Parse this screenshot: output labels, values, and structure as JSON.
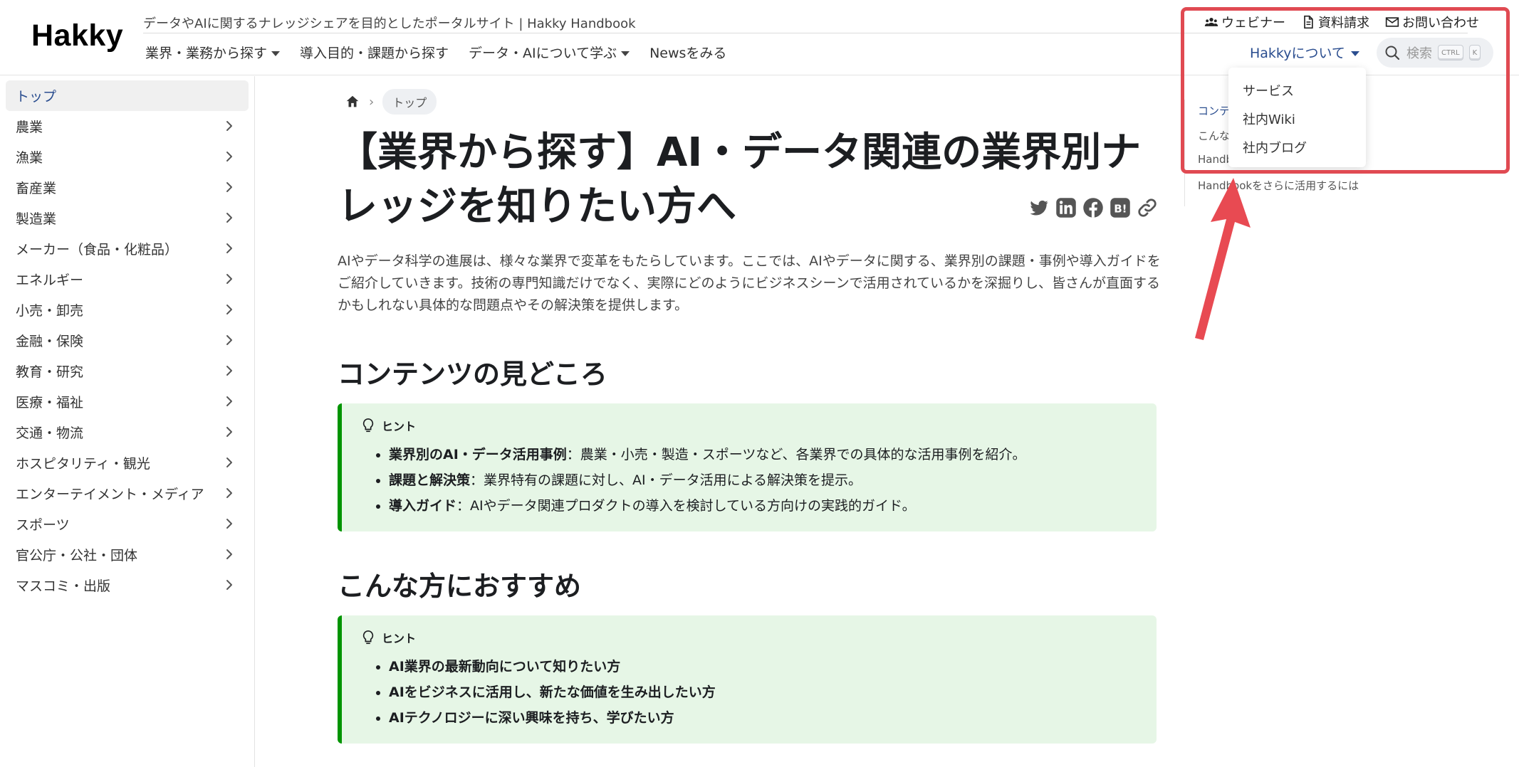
{
  "header": {
    "logo": "Hakky",
    "tagline": "データやAIに関するナレッジシェアを目的としたポータルサイト | Hakky Handbook",
    "nav": [
      {
        "label": "業界・業務から探す",
        "has_caret": true
      },
      {
        "label": "導入目的・課題から探す",
        "has_caret": false
      },
      {
        "label": "データ・AIについて学ぶ",
        "has_caret": true
      },
      {
        "label": "Newsをみる",
        "has_caret": false
      }
    ],
    "utility": [
      {
        "label": "ウェビナー",
        "icon": "users-icon"
      },
      {
        "label": "資料請求",
        "icon": "document-icon"
      },
      {
        "label": "お問い合わせ",
        "icon": "mail-icon"
      }
    ],
    "about": {
      "label": "Hakkyについて"
    },
    "search": {
      "placeholder": "検索",
      "key1": "CTRL",
      "key2": "K"
    }
  },
  "dropdown": {
    "items": [
      "サービス",
      "社内Wiki",
      "社内ブログ"
    ]
  },
  "sidebar": {
    "items": [
      {
        "label": "トップ",
        "active": true,
        "chevron": false
      },
      {
        "label": "農業",
        "active": false,
        "chevron": true
      },
      {
        "label": "漁業",
        "active": false,
        "chevron": true
      },
      {
        "label": "畜産業",
        "active": false,
        "chevron": true
      },
      {
        "label": "製造業",
        "active": false,
        "chevron": true
      },
      {
        "label": "メーカー（食品・化粧品）",
        "active": false,
        "chevron": true
      },
      {
        "label": "エネルギー",
        "active": false,
        "chevron": true
      },
      {
        "label": "小売・卸売",
        "active": false,
        "chevron": true
      },
      {
        "label": "金融・保険",
        "active": false,
        "chevron": true
      },
      {
        "label": "教育・研究",
        "active": false,
        "chevron": true
      },
      {
        "label": "医療・福祉",
        "active": false,
        "chevron": true
      },
      {
        "label": "交通・物流",
        "active": false,
        "chevron": true
      },
      {
        "label": "ホスピタリティ・観光",
        "active": false,
        "chevron": true
      },
      {
        "label": "エンターテイメント・メディア",
        "active": false,
        "chevron": true
      },
      {
        "label": "スポーツ",
        "active": false,
        "chevron": true
      },
      {
        "label": "官公庁・公社・団体",
        "active": false,
        "chevron": true
      },
      {
        "label": "マスコミ・出版",
        "active": false,
        "chevron": true
      }
    ]
  },
  "toc": {
    "items": [
      "コンテ",
      "こんな",
      "Handb",
      "Handbookをさらに活用するには"
    ]
  },
  "main": {
    "breadcrumb": {
      "current": "トップ"
    },
    "title": "【業界から探す】AI・データ関連の業界別ナレッジを知りたい方へ",
    "intro": "AIやデータ科学の進展は、様々な業界で変革をもたらしています。ここでは、AIやデータに関する、業界別の課題・事例や導入ガイドをご紹介していきます。技術の専門知識だけでなく、実際にどのようにビジネスシーンで活用されているかを深掘りし、皆さんが直面するかもしれない具体的な問題点やその解決策を提供します。",
    "sections": [
      {
        "title": "コンテンツの見どころ",
        "hint_label": "ヒント",
        "items": [
          {
            "bold": "業界別のAI・データ活用事例",
            "text": "：農業・小売・製造・スポーツなど、各業界での具体的な活用事例を紹介。"
          },
          {
            "bold": "課題と解決策",
            "text": "：業界特有の課題に対し、AI・データ活用による解決策を提示。"
          },
          {
            "bold": "導入ガイド",
            "text": "：AIやデータ関連プロダクトの導入を検討している方向けの実践的ガイド。"
          }
        ]
      },
      {
        "title": "こんな方におすすめ",
        "hint_label": "ヒント",
        "items": [
          {
            "bold": "AI業界の最新動向について知りたい方",
            "text": ""
          },
          {
            "bold": "AIをビジネスに活用し、新たな価値を生み出したい方",
            "text": ""
          },
          {
            "bold": "AIテクノロジーに深い興味を持ち、学びたい方",
            "text": ""
          }
        ]
      }
    ]
  },
  "colors": {
    "accent": "#2a4d8f",
    "hint_bg": "#e6f6e6",
    "hint_border": "#009400",
    "annotation": "#e04a52"
  }
}
